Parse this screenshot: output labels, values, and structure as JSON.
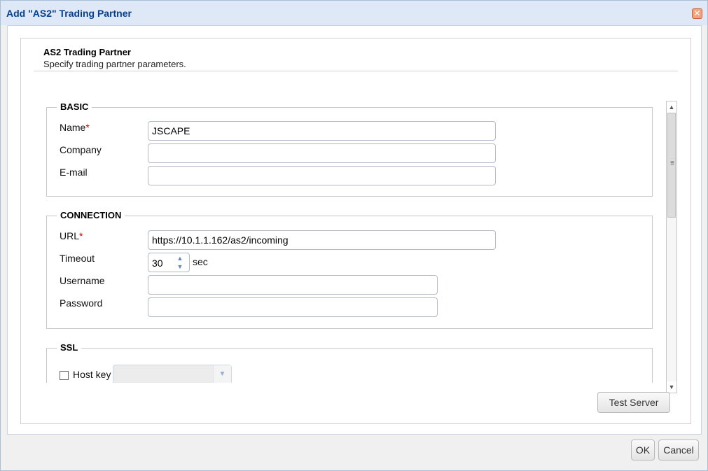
{
  "dialog": {
    "title": "Add \"AS2\" Trading Partner",
    "close_glyph": "✕"
  },
  "panel": {
    "title": "AS2 Trading Partner",
    "subtitle": "Specify trading partner parameters."
  },
  "basic": {
    "legend": "BASIC",
    "name_label": "Name",
    "required_mark": "*",
    "name_value": "JSCAPE",
    "company_label": "Company",
    "company_value": "",
    "email_label": "E-mail",
    "email_value": ""
  },
  "connection": {
    "legend": "CONNECTION",
    "url_label": "URL",
    "required_mark": "*",
    "url_value": "https://10.1.1.162/as2/incoming",
    "timeout_label": "Timeout",
    "timeout_value": "30",
    "timeout_unit": "sec",
    "username_label": "Username",
    "username_value": "",
    "password_label": "Password",
    "password_value": ""
  },
  "ssl": {
    "legend": "SSL",
    "host_key_label": "Host key",
    "host_key_checked": false
  },
  "buttons": {
    "test_server": "Test Server",
    "ok": "OK",
    "cancel": "Cancel"
  },
  "icons": {
    "close": "close-icon",
    "spin_up": "chevron-up-icon",
    "spin_down": "chevron-down-icon",
    "scroll_up": "arrow-up-icon",
    "scroll_down": "arrow-down-icon",
    "combo_trigger": "chevron-down-icon"
  },
  "colors": {
    "title_text": "#04408c",
    "titlebar_bg": "#dfe8f6",
    "required": "#cc0000"
  }
}
